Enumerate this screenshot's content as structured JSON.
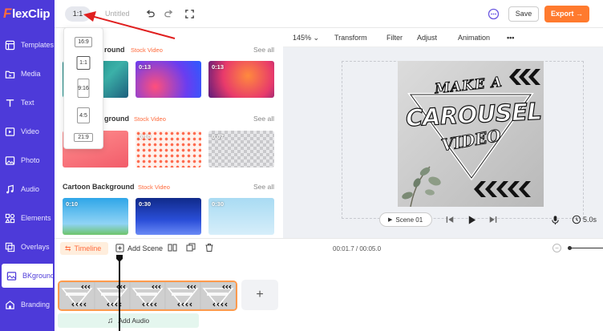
{
  "app": {
    "logo_initial": "F",
    "logo_rest": "lexClip"
  },
  "sidebar": {
    "items": [
      {
        "label": "Templates",
        "icon": "templates-icon"
      },
      {
        "label": "Media",
        "icon": "media-icon"
      },
      {
        "label": "Text",
        "icon": "text-icon"
      },
      {
        "label": "Video",
        "icon": "video-icon"
      },
      {
        "label": "Photo",
        "icon": "photo-icon"
      },
      {
        "label": "Audio",
        "icon": "audio-icon"
      },
      {
        "label": "Elements",
        "icon": "elements-icon"
      },
      {
        "label": "Overlays",
        "icon": "overlays-icon"
      },
      {
        "label": "BKground",
        "icon": "background-icon",
        "active": true
      },
      {
        "label": "Branding",
        "icon": "branding-icon"
      }
    ]
  },
  "topbar": {
    "ratio": "1:1",
    "title": "Untitled",
    "save_label": "Save",
    "export_label": "Export →"
  },
  "ratio_menu": {
    "options": [
      "16:9",
      "1:1",
      "9:16",
      "4:5",
      "21:9"
    ],
    "selected": "1:1"
  },
  "panel": {
    "sections": [
      {
        "title": "round",
        "tag": "Stock Video",
        "see_all": "See all",
        "thumbs": [
          {
            "duration": ""
          },
          {
            "duration": "0:13"
          },
          {
            "duration": "0:13"
          }
        ]
      },
      {
        "title": "ground",
        "tag": "Stock Video",
        "see_all": "See all",
        "thumbs": [
          {
            "duration": ""
          },
          {
            "duration": "0:10"
          },
          {
            "duration": "0:07"
          }
        ]
      },
      {
        "title": "Cartoon Background",
        "tag": "Stock Video",
        "see_all": "See all",
        "thumbs": [
          {
            "duration": "0:10"
          },
          {
            "duration": "0:30"
          },
          {
            "duration": "0:30"
          }
        ]
      }
    ]
  },
  "editor_toolbar": {
    "zoom": "145%",
    "items": [
      "Transform",
      "Filter",
      "Adjust",
      "Animation"
    ]
  },
  "canvas": {
    "line1": "MAKE A",
    "line2": "CAROUSEL",
    "line3": "VIDEO"
  },
  "player": {
    "scene_label": "Scene 01",
    "duration": "5.0s"
  },
  "timeline": {
    "label": "Timeline",
    "add_scene": "Add Scene",
    "time": "00:01.7 / 00:05.0",
    "add_audio": "Add Audio"
  },
  "colors": {
    "sidebar": "#4d3ad9",
    "accent": "#ff7a2e",
    "stock_tag": "#ff6b3d"
  }
}
